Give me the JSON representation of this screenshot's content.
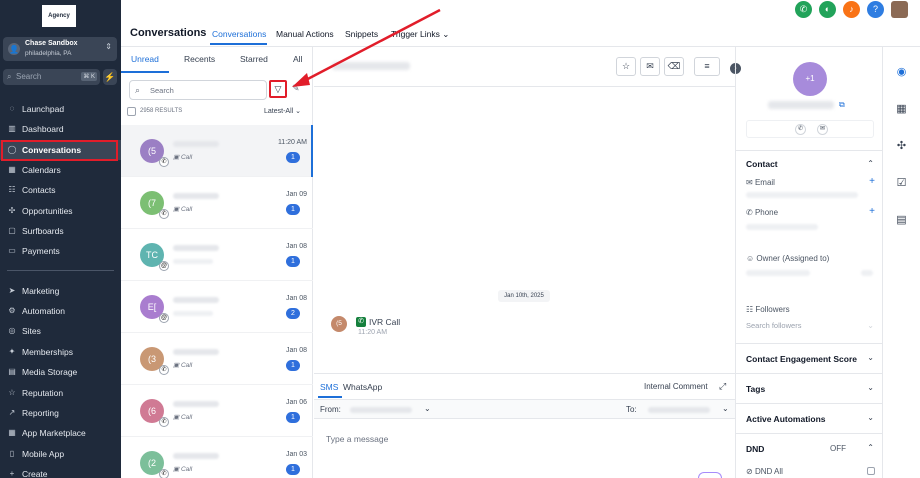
{
  "sidebar": {
    "logo_text": "Agency",
    "account": {
      "avatar_glyph": "👤",
      "name": "Chase Sandbox",
      "location": "philadelphia, PA"
    },
    "search_placeholder": "Search",
    "search_shortcut": "⌘ K",
    "nav": [
      {
        "label": "Launchpad",
        "icon": "rocket-icon",
        "glyph": "◌"
      },
      {
        "label": "Dashboard",
        "icon": "dashboard-icon",
        "glyph": "▥"
      },
      {
        "label": "Conversations",
        "icon": "chat-icon",
        "glyph": "◯",
        "active": true
      },
      {
        "label": "Calendars",
        "icon": "calendar-icon",
        "glyph": "▦"
      },
      {
        "label": "Contacts",
        "icon": "contacts-icon",
        "glyph": "☷"
      },
      {
        "label": "Opportunities",
        "icon": "opportunities-icon",
        "glyph": "✣"
      },
      {
        "label": "Surfboards",
        "icon": "surfboards-icon",
        "glyph": "▢"
      },
      {
        "label": "Payments",
        "icon": "payments-icon",
        "glyph": "▭"
      },
      {
        "label": "Marketing",
        "icon": "marketing-icon",
        "glyph": "➤"
      },
      {
        "label": "Automation",
        "icon": "automation-icon",
        "glyph": "⚙"
      },
      {
        "label": "Sites",
        "icon": "sites-icon",
        "glyph": "◎"
      },
      {
        "label": "Memberships",
        "icon": "memberships-icon",
        "glyph": "✦"
      },
      {
        "label": "Media Storage",
        "icon": "media-icon",
        "glyph": "▤"
      },
      {
        "label": "Reputation",
        "icon": "reputation-icon",
        "glyph": "☆"
      },
      {
        "label": "Reporting",
        "icon": "reporting-icon",
        "glyph": "↗"
      },
      {
        "label": "App Marketplace",
        "icon": "marketplace-icon",
        "glyph": "▦"
      },
      {
        "label": "Mobile App",
        "icon": "mobile-icon",
        "glyph": "▯"
      },
      {
        "label": "Create",
        "icon": "create-icon",
        "glyph": "+"
      }
    ]
  },
  "header": {
    "title": "Conversations",
    "tabs": [
      "Conversations",
      "Manual Actions",
      "Snippets",
      "Trigger Links"
    ],
    "trigger_chevron": "⌄",
    "icons": [
      {
        "name": "phone-icon",
        "glyph": "✆",
        "color": "#22a35a"
      },
      {
        "name": "megaphone-icon",
        "glyph": "◐",
        "color": "#22a35a"
      },
      {
        "name": "bell-icon",
        "glyph": "♪",
        "color": "#f97316"
      },
      {
        "name": "help-icon",
        "glyph": "?",
        "color": "#2f7de1"
      }
    ],
    "colors": {
      "accent": "#1d6fd8",
      "highlight_red": "#e11d2a"
    }
  },
  "list": {
    "tabs": [
      "Unread",
      "Recents",
      "Starred",
      "All"
    ],
    "search_placeholder": "Search",
    "results_label": "2958 RESULTS",
    "sort_label": "Latest-All",
    "conversations": [
      {
        "initials": "(5",
        "color": "#9b7fc4",
        "kind": "Call",
        "time": "11:20 AM",
        "count": "1",
        "selected": true
      },
      {
        "initials": "(7",
        "color": "#7cbf73",
        "kind": "Call",
        "time": "Jan 09",
        "count": "1"
      },
      {
        "initials": "TC",
        "color": "#5fb4b0",
        "kind": "",
        "time": "Jan 08",
        "count": "1",
        "badge": "@"
      },
      {
        "initials": "E[",
        "color": "#a97dcf",
        "kind": "",
        "time": "Jan 08",
        "count": "2",
        "badge": "@"
      },
      {
        "initials": "(3",
        "color": "#c99874",
        "kind": "Call",
        "time": "Jan 08",
        "count": "1"
      },
      {
        "initials": "(6",
        "color": "#d07a94",
        "kind": "Call",
        "time": "Jan 06",
        "count": "1"
      },
      {
        "initials": "(2",
        "color": "#7cbf9a",
        "kind": "Call",
        "time": "Jan 03",
        "count": "1"
      }
    ]
  },
  "chat": {
    "date_divider": "Jan 10th, 2025",
    "message": {
      "initials": "(5",
      "title": "IVR Call",
      "time": "11:20 AM"
    },
    "composer": {
      "tabs": [
        "SMS",
        "WhatsApp"
      ],
      "internal_comment": "Internal Comment",
      "from_label": "From:",
      "to_label": "To:",
      "placeholder": "Type a message"
    }
  },
  "contact": {
    "avatar_text": "+1",
    "sections": {
      "contact": "Contact",
      "email": "Email",
      "phone": "Phone",
      "owner": "Owner (Assigned to)",
      "followers": "Followers",
      "followers_placeholder": "Search followers",
      "engagement": "Contact Engagement Score",
      "tags": "Tags",
      "automations": "Active Automations",
      "dnd": "DND",
      "dnd_status": "OFF",
      "dnd_all": "DND All"
    }
  }
}
